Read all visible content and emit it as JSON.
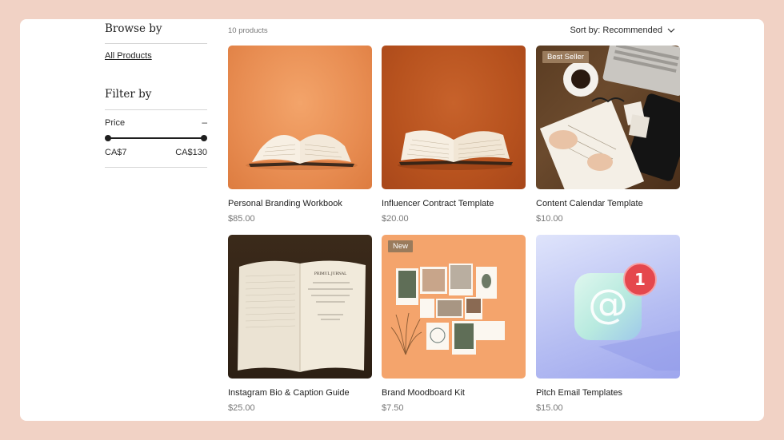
{
  "sidebar": {
    "browse_heading": "Browse by",
    "all_products": "All Products",
    "filter_heading": "Filter by",
    "price_label": "Price",
    "collapse_symbol": "–",
    "price_min": "CA$7",
    "price_max": "CA$130"
  },
  "toolbar": {
    "count": "10 products",
    "sort_label": "Sort by: Recommended"
  },
  "products": [
    {
      "name": "Personal Branding Workbook",
      "price": "$85.00",
      "badge": ""
    },
    {
      "name": "Influencer Contract Template",
      "price": "$20.00",
      "badge": ""
    },
    {
      "name": "Content Calendar Template",
      "price": "$10.00",
      "badge": "Best Seller"
    },
    {
      "name": "Instagram Bio & Caption Guide",
      "price": "$25.00",
      "badge": ""
    },
    {
      "name": "Brand Moodboard Kit",
      "price": "$7.50",
      "badge": "New"
    },
    {
      "name": "Pitch Email Templates",
      "price": "$15.00",
      "badge": ""
    }
  ],
  "image_text": {
    "journal_title": "PRIMUL JURNAL",
    "notification_count": "1",
    "email_glyph": "@"
  },
  "colors": {
    "page_background": "#f1d2c5",
    "badge_background": "#9a7b5c",
    "notification_red": "#e5484d"
  }
}
